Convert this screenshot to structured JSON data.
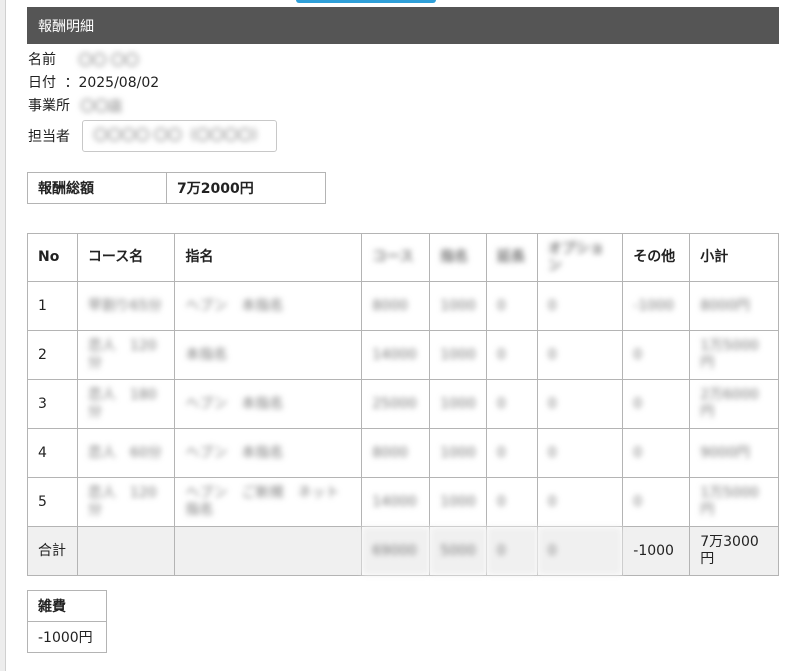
{
  "page": {
    "title": "報酬明細",
    "fields": {
      "name_label": "名前",
      "name_value": "〇〇 〇〇",
      "date_label": "日付",
      "date_value": "：2025/08/02",
      "office_label": "事業所",
      "office_value": "〇〇店",
      "staff_label": "担当者",
      "staff_value": "〇〇〇〇 〇〇（〇〇〇〇）"
    }
  },
  "summary": {
    "label": "報酬総額",
    "value": "7万2000円"
  },
  "table": {
    "headers": [
      "No",
      "コース名",
      "指名",
      "コース",
      "指名",
      "延長",
      "オプション",
      "その他",
      "小計"
    ],
    "rows": [
      [
        "1",
        "早割り65分",
        "ヘブン　本指名",
        "8000",
        "1000",
        "0",
        "0",
        "-1000",
        "8000円"
      ],
      [
        "2",
        "恋人　120分",
        "本指名",
        "14000",
        "1000",
        "0",
        "0",
        "0",
        "1万5000円"
      ],
      [
        "3",
        "恋人　180分",
        "ヘブン　本指名",
        "25000",
        "1000",
        "0",
        "0",
        "0",
        "2万6000円"
      ],
      [
        "4",
        "恋人　60分",
        "ヘブン　本指名",
        "8000",
        "1000",
        "0",
        "0",
        "0",
        "9000円"
      ],
      [
        "5",
        "恋人　120分",
        "ヘブン　ご新規　ネット指名",
        "14000",
        "1000",
        "0",
        "0",
        "0",
        "1万5000円"
      ]
    ],
    "total": [
      "合計",
      "",
      "",
      "69000",
      "5000",
      "0",
      "0",
      "-1000",
      "7万3000円"
    ]
  },
  "misc": {
    "label": "雑費",
    "value": "-1000円"
  }
}
